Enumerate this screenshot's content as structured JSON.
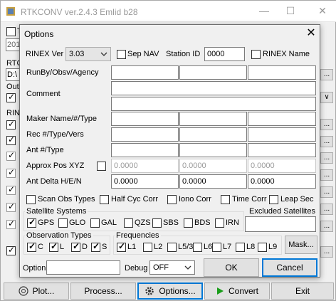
{
  "main_window": {
    "title": "RTKCONV ver.2.4.3 Emlid b28",
    "controls": {
      "minimize": "—",
      "maximize": "☐",
      "close": "✕"
    },
    "partial": {
      "t_label": "T",
      "year": "201",
      "rtc": "RTC",
      "path": "D:\\",
      "out": "Out",
      "rin": "RIN",
      "dots": "...",
      "chev": "∨"
    },
    "buttons": {
      "plot": "Plot...",
      "process": "Process...",
      "options": "Options...",
      "convert": "Convert",
      "exit": "Exit"
    }
  },
  "dialog": {
    "title": "Options",
    "rinex_ver_label": "RINEX Ver",
    "rinex_ver_value": "3.03",
    "sep_nav_label": "Sep NAV",
    "station_id_label": "Station ID",
    "station_id_value": "0000",
    "rinex_name_label": "RINEX Name",
    "runby_label": "RunBy/Obsv/Agency",
    "comment_label": "Comment",
    "marker_label": "Maker Name/#/Type",
    "rec_label": "Rec #/Type/Vers",
    "ant_label": "Ant #/Type",
    "approx_label": "Approx Pos XYZ",
    "approx_values": [
      "0.0000",
      "0.0000",
      "0.0000"
    ],
    "ant_delta_label": "Ant Delta H/E/N",
    "ant_delta_values": [
      "0.0000",
      "0.0000",
      "0.0000"
    ],
    "opts": {
      "scan_obs": "Scan Obs Types",
      "half_cyc": "Half Cyc Corr",
      "iono": "Iono Corr",
      "time": "Time Corr",
      "leap": "Leap Sec"
    },
    "sat_sys": {
      "label": "Satellite Systems",
      "items": [
        "GPS",
        "GLO",
        "GAL",
        "QZS",
        "SBS",
        "BDS",
        "IRN"
      ],
      "checked": [
        true,
        false,
        false,
        false,
        false,
        false,
        false
      ]
    },
    "excluded_label": "Excluded Satellites",
    "obs_types": {
      "label": "Observation Types",
      "items": [
        "C",
        "L",
        "D",
        "S"
      ],
      "checked": [
        true,
        true,
        true,
        true
      ]
    },
    "freqs": {
      "label": "Frequencies",
      "items": [
        "L1",
        "L2",
        "L5/3",
        "L6",
        "L7",
        "L8",
        "L9"
      ],
      "checked": [
        true,
        false,
        false,
        false,
        false,
        false,
        false
      ]
    },
    "mask_label": "Mask...",
    "option_label": "Option",
    "debug_label": "Debug",
    "debug_value": "OFF",
    "ok_label": "OK",
    "cancel_label": "Cancel",
    "close_glyph": "✕"
  },
  "colors": {
    "accent": "#0078d7",
    "convert_green": "#1a9e1a"
  }
}
